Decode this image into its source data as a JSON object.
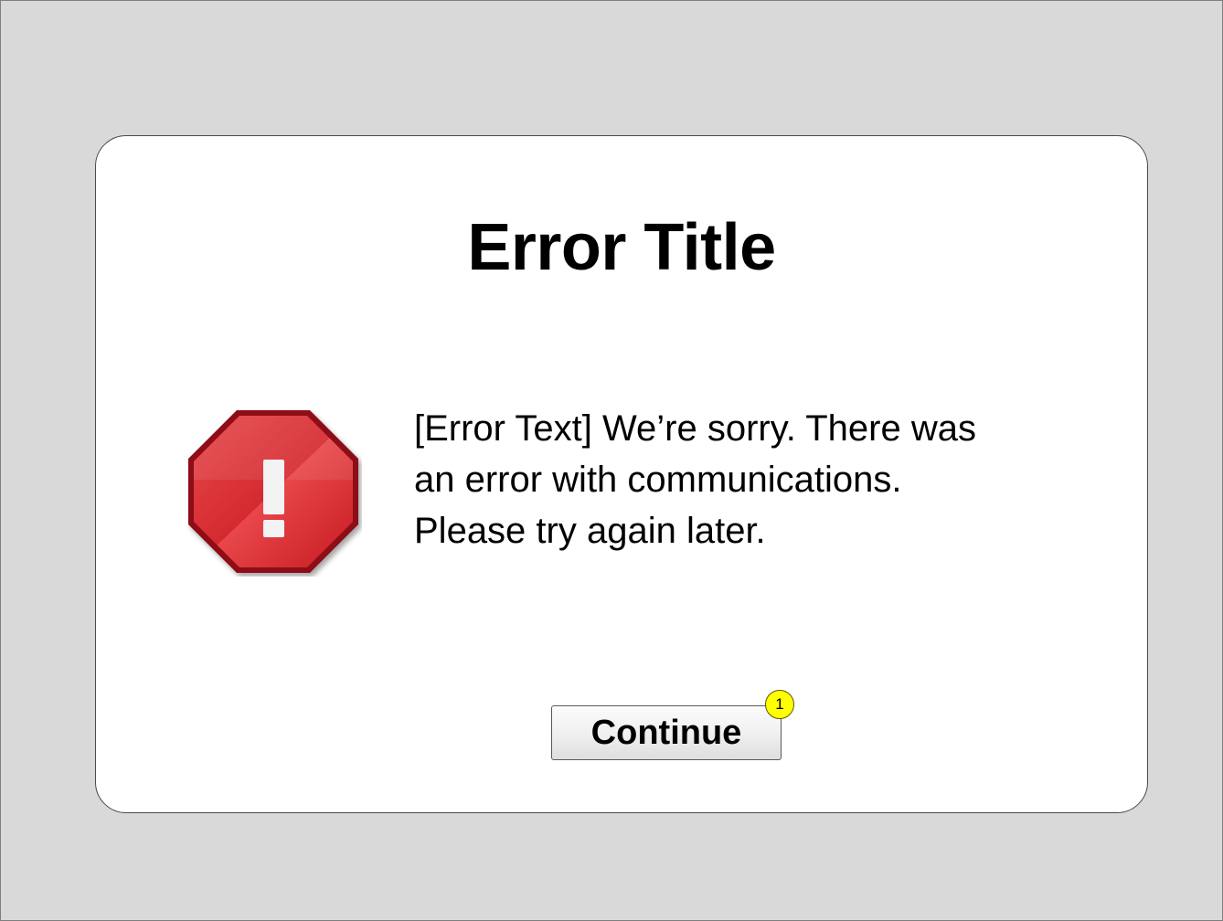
{
  "dialog": {
    "title": "Error Title",
    "message_lines": [
      "[Error Text] We’re sorry. There was",
      "an error with communications.",
      "Please try again later."
    ],
    "icon": "error-stop-icon",
    "continue_label": "Continue",
    "annotation_badge": "1"
  },
  "colors": {
    "background": "#d9d9d9",
    "dialog_background": "#ffffff",
    "icon_red": "#cc1f24",
    "badge_yellow": "#ffff00"
  }
}
